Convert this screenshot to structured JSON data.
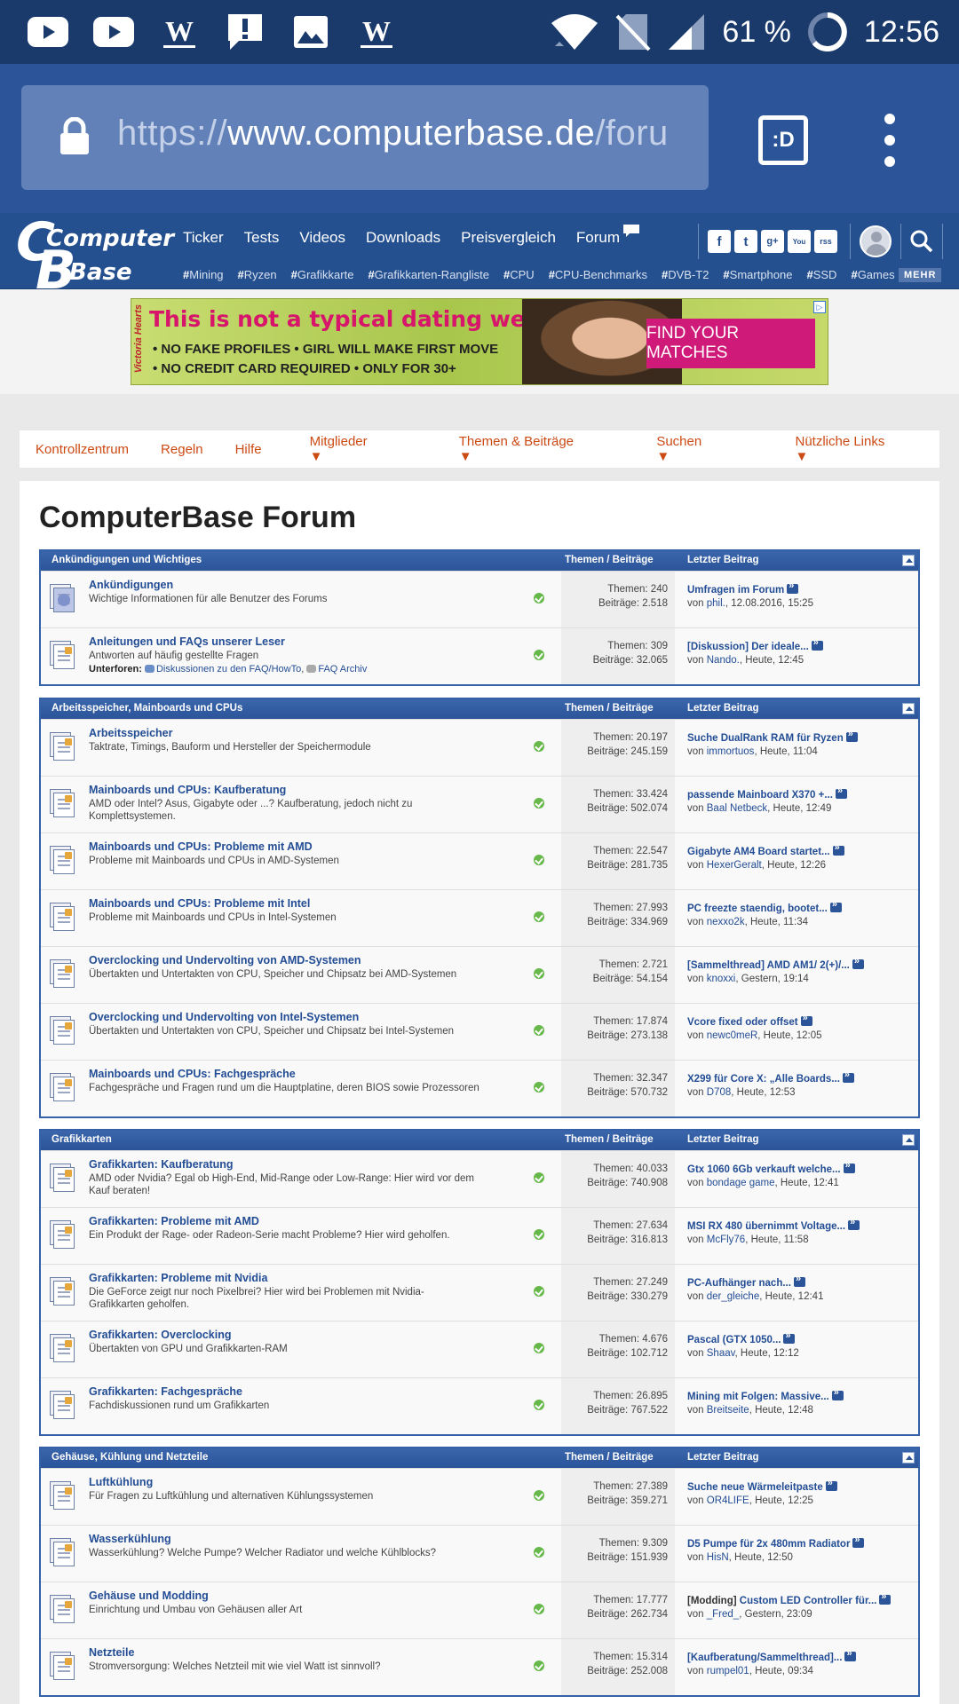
{
  "status_bar": {
    "battery": "61 %",
    "time": "12:56",
    "app_icons": [
      "youtube-icon",
      "youtube-icon",
      "wikipedia-icon",
      "alert-icon",
      "gallery-icon",
      "wikipedia-icon"
    ]
  },
  "browser": {
    "url_scheme": "https://",
    "url_host": "www.computerbase.de",
    "url_path": "/foru",
    "tab_label": ":D"
  },
  "site": {
    "logo_line1": "Computer",
    "logo_line2": "Base",
    "nav": [
      "Ticker",
      "Tests",
      "Videos",
      "Downloads",
      "Preisvergleich",
      "Forum"
    ],
    "tags": [
      "Mining",
      "Ryzen",
      "Grafikkarte",
      "Grafikkarten-Rangliste",
      "CPU",
      "CPU-Benchmarks",
      "DVB-T2",
      "Smartphone",
      "SSD",
      "Games"
    ],
    "more_label": "MEHR",
    "social": [
      "f",
      "t",
      "g+",
      "You",
      "rss"
    ]
  },
  "ad": {
    "title": "This is not a typical dating website",
    "line1": "• NO FAKE PROFILES  • GIRL WILL MAKE FIRST MOVE",
    "line2": "• NO CREDIT CARD REQUIRED  • ONLY FOR 30+",
    "button": "FIND YOUR MATCHES",
    "brand": "Victoria Hearts"
  },
  "forum_nav": [
    "Kontrollzentrum",
    "Regeln",
    "Hilfe",
    "Mitglieder",
    "Themen & Beiträge",
    "Suchen",
    "Nützliche Links"
  ],
  "page_title": "ComputerBase Forum",
  "col_headers": {
    "stats": "Themen / Beiträge",
    "last": "Letzter Beitrag"
  },
  "categories": [
    {
      "title": "Ankündigungen und Wichtiges",
      "forums": [
        {
          "title": "Ankündigungen",
          "desc": "Wichtige Informationen für alle Benutzer des Forums",
          "threads": "Themen: 240",
          "posts": "Beiträge: 2.518",
          "last_prefix": "",
          "last_title": "Umfragen im Forum",
          "last_by": "von",
          "last_user": "phil.",
          "last_time": ", 12.08.2016, 15:25",
          "icon": "announcement"
        },
        {
          "title": "Anleitungen und FAQs unserer Leser",
          "desc": "Antworten auf häufig gestellte Fragen",
          "sub_label": "Unterforen:",
          "sub1": "Diskussionen zu den FAQ/HowTo",
          "sub2": "FAQ Archiv",
          "threads": "Themen: 309",
          "posts": "Beiträge: 32.065",
          "last_prefix": "",
          "last_title": "[Diskussion] Der ideale...",
          "last_by": "von",
          "last_user": "Nando.",
          "last_time": ", Heute, 12:45",
          "icon": "forum"
        }
      ]
    },
    {
      "title": "Arbeitsspeicher, Mainboards und CPUs",
      "forums": [
        {
          "title": "Arbeitsspeicher",
          "desc": "Taktrate, Timings, Bauform und Hersteller der Speichermodule",
          "threads": "Themen: 20.197",
          "posts": "Beiträge: 245.159",
          "last_prefix": "",
          "last_title": "Suche DualRank RAM für Ryzen",
          "last_by": "von",
          "last_user": "immortuos",
          "last_time": ", Heute, 11:04"
        },
        {
          "title": "Mainboards und CPUs: Kaufberatung",
          "desc": "AMD oder Intel? Asus, Gigabyte oder ...? Kaufberatung, jedoch nicht zu Komplettsystemen.",
          "threads": "Themen: 33.424",
          "posts": "Beiträge: 502.074",
          "last_prefix": "",
          "last_title": "passende Mainboard X370 +...",
          "last_by": "von",
          "last_user": "Baal Netbeck",
          "last_time": ", Heute, 12:49"
        },
        {
          "title": "Mainboards und CPUs: Probleme mit AMD",
          "desc": "Probleme mit Mainboards und CPUs in AMD-Systemen",
          "threads": "Themen: 22.547",
          "posts": "Beiträge: 281.735",
          "last_prefix": "",
          "last_title": "Gigabyte AM4 Board startet...",
          "last_by": "von",
          "last_user": "HexerGeralt",
          "last_time": ", Heute, 12:26"
        },
        {
          "title": "Mainboards und CPUs: Probleme mit Intel",
          "desc": "Probleme mit Mainboards und CPUs in Intel-Systemen",
          "threads": "Themen: 27.993",
          "posts": "Beiträge: 334.969",
          "last_prefix": "",
          "last_title": "PC freezte staendig, bootet...",
          "last_by": "von",
          "last_user": "nexxo2k",
          "last_time": ", Heute, 11:34"
        },
        {
          "title": "Overclocking und Undervolting von AMD-Systemen",
          "desc": "Übertakten und Untertakten von CPU, Speicher und Chipsatz bei AMD-Systemen",
          "threads": "Themen: 2.721",
          "posts": "Beiträge: 54.154",
          "last_prefix": "",
          "last_title": "[Sammelthread] AMD AM1/ 2(+)/...",
          "last_by": "von",
          "last_user": "knoxxi",
          "last_time": ", Gestern, 19:14"
        },
        {
          "title": "Overclocking und Undervolting von Intel-Systemen",
          "desc": "Übertakten und Untertakten von CPU, Speicher und Chipsatz bei Intel-Systemen",
          "threads": "Themen: 17.874",
          "posts": "Beiträge: 273.138",
          "last_prefix": "",
          "last_title": "Vcore fixed oder offset",
          "last_by": "von",
          "last_user": "newc0meR",
          "last_time": ", Heute, 12:05"
        },
        {
          "title": "Mainboards und CPUs: Fachgespräche",
          "desc": "Fachgespräche und Fragen rund um die Hauptplatine, deren BIOS sowie Prozessoren",
          "threads": "Themen: 32.347",
          "posts": "Beiträge: 570.732",
          "last_prefix": "",
          "last_title": "X299 für Core X: „Alle Boards...",
          "last_by": "von",
          "last_user": "D708",
          "last_time": ", Heute, 12:53"
        }
      ]
    },
    {
      "title": "Grafikkarten",
      "forums": [
        {
          "title": "Grafikkarten: Kaufberatung",
          "desc": "AMD oder Nvidia? Egal ob High-End, Mid-Range oder Low-Range: Hier wird vor dem Kauf beraten!",
          "threads": "Themen: 40.033",
          "posts": "Beiträge: 740.908",
          "last_prefix": "",
          "last_title": "Gtx 1060 6Gb verkauft welche...",
          "last_by": "von",
          "last_user": "bondage game",
          "last_time": ", Heute, 12:41"
        },
        {
          "title": "Grafikkarten: Probleme mit AMD",
          "desc": "Ein Produkt der Rage- oder Radeon-Serie macht Probleme? Hier wird geholfen.",
          "threads": "Themen: 27.634",
          "posts": "Beiträge: 316.813",
          "last_prefix": "",
          "last_title": "MSI RX 480 übernimmt Voltage...",
          "last_by": "von",
          "last_user": "McFly76",
          "last_time": ", Heute, 11:58"
        },
        {
          "title": "Grafikkarten: Probleme mit Nvidia",
          "desc": "Die GeForce zeigt nur noch Pixelbrei? Hier wird bei Problemen mit Nvidia-Grafikkarten geholfen.",
          "threads": "Themen: 27.249",
          "posts": "Beiträge: 330.279",
          "last_prefix": "",
          "last_title": "PC-Aufhänger nach...",
          "last_by": "von",
          "last_user": "der_gleiche",
          "last_time": ", Heute, 12:41"
        },
        {
          "title": "Grafikkarten: Overclocking",
          "desc": "Übertakten von GPU und Grafikkarten-RAM",
          "threads": "Themen: 4.676",
          "posts": "Beiträge: 102.712",
          "last_prefix": "",
          "last_title": "Pascal (GTX 1050...",
          "last_by": "von",
          "last_user": "Shaav",
          "last_time": ", Heute, 12:12"
        },
        {
          "title": "Grafikkarten: Fachgespräche",
          "desc": "Fachdiskussionen rund um Grafikkarten",
          "threads": "Themen: 26.895",
          "posts": "Beiträge: 767.522",
          "last_prefix": "",
          "last_title": "Mining mit Folgen: Massive...",
          "last_by": "von",
          "last_user": "Breitseite",
          "last_time": ", Heute, 12:48"
        }
      ]
    },
    {
      "title": "Gehäuse, Kühlung und Netzteile",
      "forums": [
        {
          "title": "Luftkühlung",
          "desc": "Für Fragen zu Luftkühlung und alternativen Kühlungssystemen",
          "threads": "Themen: 27.389",
          "posts": "Beiträge: 359.271",
          "last_prefix": "",
          "last_title": "Suche neue Wärmeleitpaste",
          "last_by": "von",
          "last_user": "OR4LIFE",
          "last_time": ", Heute, 12:25"
        },
        {
          "title": "Wasserkühlung",
          "desc": "Wasserkühlung? Welche Pumpe? Welcher Radiator und welche Kühlblocks?",
          "threads": "Themen: 9.309",
          "posts": "Beiträge: 151.939",
          "last_prefix": "",
          "last_title": "D5 Pumpe für 2x 480mm Radiator",
          "last_by": "von",
          "last_user": "HisN",
          "last_time": ", Heute, 12:50"
        },
        {
          "title": "Gehäuse und Modding",
          "desc": "Einrichtung und Umbau von Gehäusen aller Art",
          "threads": "Themen: 17.777",
          "posts": "Beiträge: 262.734",
          "last_prefix": "[Modding] ",
          "last_title": "Custom LED Controller für...",
          "last_by": "von",
          "last_user": "_Fred_",
          "last_time": ", Gestern, 23:09"
        },
        {
          "title": "Netzteile",
          "desc": "Stromversorgung: Welches Netzteil mit wie viel Watt ist sinnvoll?",
          "threads": "Themen: 15.314",
          "posts": "Beiträge: 252.008",
          "last_prefix": "",
          "last_title": "[Kaufberatung/Sammelthread]...",
          "last_by": "von",
          "last_user": "rumpel01",
          "last_time": ", Heute, 09:34"
        }
      ]
    }
  ]
}
